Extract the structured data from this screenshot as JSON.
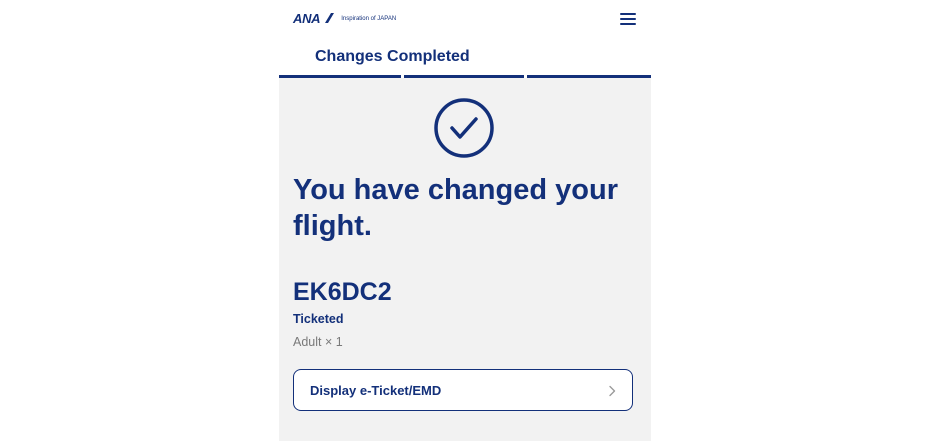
{
  "header": {
    "logo_text": "ANA",
    "tagline": "Inspiration of JAPAN",
    "menu_icon": "hamburger-menu-icon"
  },
  "steps": {
    "title": "Changes Completed",
    "count": 3,
    "current": 3
  },
  "confirmation": {
    "icon": "check-circle-icon",
    "headline": "You have changed your flight.",
    "booking_reference": "EK6DC2",
    "status": "Ticketed",
    "passengers": "Adult × 1"
  },
  "actions": {
    "display_eticket_label": "Display e-Ticket/EMD",
    "chevron_icon": "chevron-right-icon"
  },
  "colors": {
    "brand_navy": "#13307a",
    "background": "#f2f2f2",
    "muted_text": "#7a7a7a"
  }
}
